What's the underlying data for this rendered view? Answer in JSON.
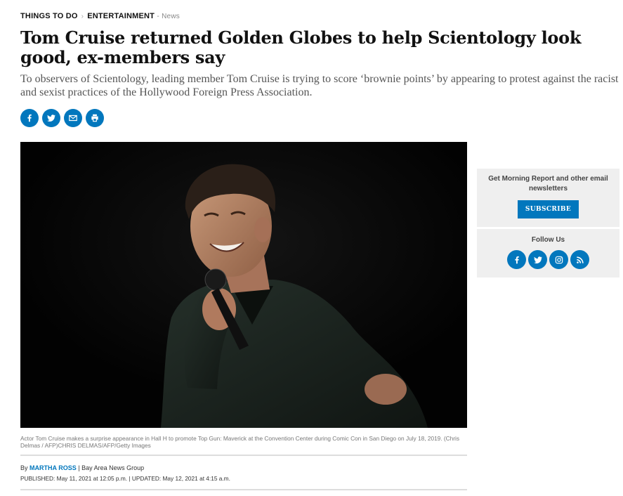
{
  "breadcrumb": {
    "section": "THINGS TO DO",
    "category": "ENTERTAINMENT",
    "separator": "›",
    "dash": "-",
    "type": "News"
  },
  "article": {
    "headline": "Tom Cruise returned Golden Globes to help Scientology look good, ex-members say",
    "dek": "To observers of Scientology, leading member Tom Cruise is trying to score ‘brownie points’ by appearing to protest against the racist and sexist practices of the Hollywood Foreign Press Association.",
    "caption": "Actor Tom Cruise makes a surprise appearance in Hall H to promote Top Gun: Maverick at the Convention Center during Comic Con in San Diego on July 18, 2019. (Chris Delmas / AFP)CHRIS DELMAS/AFP/Getty Images",
    "byline": {
      "by": "By",
      "author": "MARTHA ROSS",
      "divider": "|",
      "org": "Bay Area News Group"
    },
    "dates": {
      "published_label": "PUBLISHED:",
      "published": "May 11, 2021 at 12:05 p.m.",
      "divider": "|",
      "updated_label": "UPDATED:",
      "updated": "May 12, 2021 at 4:15 a.m."
    }
  },
  "share": {
    "icons": [
      "facebook-icon",
      "twitter-icon",
      "email-icon",
      "print-icon"
    ],
    "color": "#0277bd"
  },
  "sidebar": {
    "newsletter_text": "Get Morning Report and other email newsletters",
    "subscribe_label": "SUBSCRIBE",
    "follow_title": "Follow Us",
    "follow_icons": [
      "facebook-icon",
      "twitter-icon",
      "instagram-icon",
      "rss-icon"
    ]
  },
  "colors": {
    "accent": "#0277bd",
    "sidebar_bg": "#efefef",
    "photo_bg": "#050505"
  }
}
